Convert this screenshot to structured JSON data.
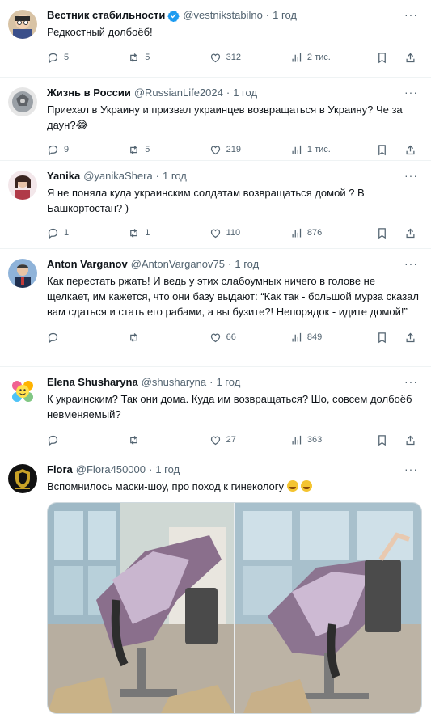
{
  "tweets": [
    {
      "name": "Вестник стабильности",
      "handle": "@vestnikstabilno",
      "time": "1 год",
      "verified": true,
      "text": "Редкостный долбоёб!",
      "replies": "5",
      "reposts": "5",
      "likes": "312",
      "views": "2 тис."
    },
    {
      "name": "Жизнь в России",
      "handle": "@RussianLife2024",
      "time": "1 год",
      "verified": false,
      "text": "Приехал в Украину и призвал украинцев возвращаться в Украину? Че за даун?😂",
      "replies": "9",
      "reposts": "5",
      "likes": "219",
      "views": "1 тис."
    },
    {
      "name": "Yanika",
      "handle": "@yanikaShera",
      "time": "1 год",
      "verified": false,
      "text": "Я не поняла куда украинским солдатам возвращаться домой ? В Башкортостан? )",
      "replies": "1",
      "reposts": "1",
      "likes": "110",
      "views": "876"
    },
    {
      "name": "Anton Varganov",
      "handle": "@AntonVarganov75",
      "time": "1 год",
      "verified": false,
      "text": "Как перестать ржать! И ведь у этих слабоумных ничего в голове не щелкает, им кажется, что они базу выдают: “Как так - большой мурза сказал вам сдаться и стать его рабами, а вы бузите?! Непорядок - идите домой!”",
      "replies": "",
      "reposts": "",
      "likes": "66",
      "views": "849"
    },
    {
      "name": "Elena Shusharyna",
      "handle": "@shusharyna",
      "time": "1 год",
      "verified": false,
      "text": "К украинским? Так они дома. Куда им возвращаться? Шо, совсем долбоёб невменяемый?",
      "replies": "",
      "reposts": "",
      "likes": "27",
      "views": "363"
    },
    {
      "name": "Flora",
      "handle": "@Flora450000",
      "time": "1 год",
      "verified": false,
      "text": "Вспомнилось маски-шоу, про поход к гинекологу",
      "replies": "",
      "reposts": "",
      "likes": "",
      "views": ""
    }
  ],
  "ui": {
    "dot": "·",
    "more": "···"
  },
  "colors": {
    "verified": "#1d9bf0",
    "muted": "#536471",
    "divider": "#eff3f4"
  }
}
